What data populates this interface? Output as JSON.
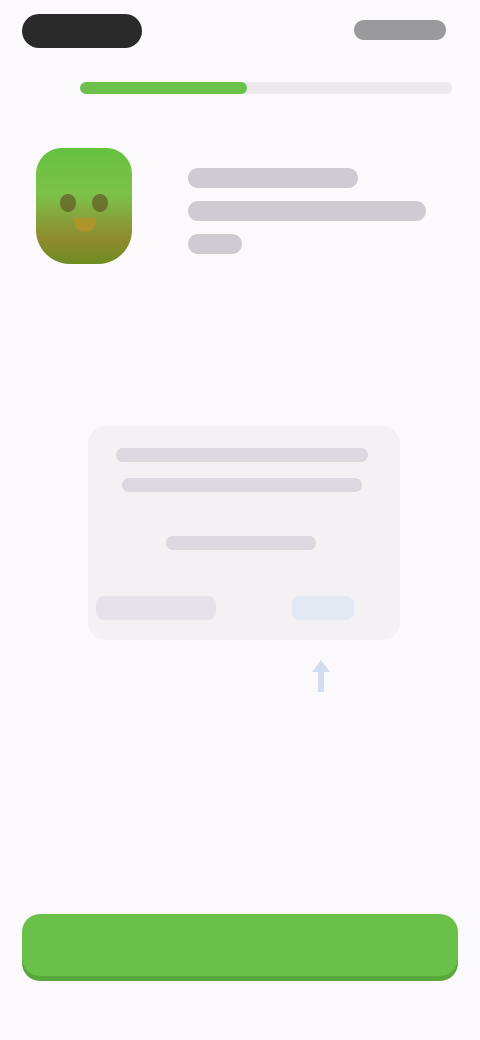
{
  "status_bar": {
    "time": "",
    "icons": [
      "signal-icon",
      "wifi-icon",
      "battery-icon"
    ]
  },
  "progress": {
    "value": 0.45
  },
  "mascot": {
    "icon": "mascot-icon"
  },
  "speech": {
    "lines": [
      "",
      "",
      ""
    ]
  },
  "card": {
    "lines": [
      "",
      "",
      ""
    ],
    "choices": [
      "",
      ""
    ]
  },
  "pointer": {
    "icon": "pointer-icon"
  },
  "bottom_button": {
    "label": ""
  },
  "colors": {
    "accent": "#6ac049",
    "accent_shadow": "#58a63c",
    "background": "#fbf9fc",
    "track": "#ece8ee"
  }
}
